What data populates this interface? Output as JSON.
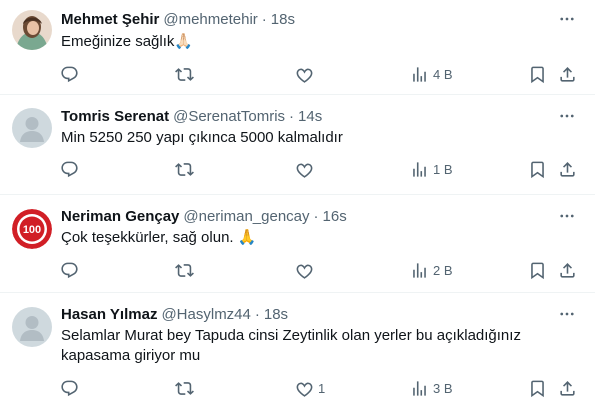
{
  "tweets": [
    {
      "name": "Mehmet Şehir",
      "handle": "@mehmetehir",
      "dot": "·",
      "time": "18s",
      "text": "Emeğinize sağlık",
      "emoji": "🙏🏻",
      "replies": "",
      "retweets": "",
      "likes": "",
      "views": "4 B"
    },
    {
      "name": "Tomris Serenat",
      "handle": "@SerenatTomris",
      "dot": "·",
      "time": "14s",
      "text": "Min 5250 250 yapı çıkınca 5000 kalmalıdır",
      "replies": "",
      "retweets": "",
      "likes": "",
      "views": "1 B"
    },
    {
      "name": "Neriman Gençay",
      "handle": "@neriman_gencay",
      "dot": "·",
      "time": "16s",
      "text": "Çok teşekkürler, sağ olun.",
      "emoji": "🙏",
      "avatar_text": "100",
      "replies": "",
      "retweets": "",
      "likes": "",
      "views": "2 B"
    },
    {
      "name": "Hasan Yılmaz",
      "handle": "@Hasylmz44",
      "dot": "·",
      "time": "18s",
      "text": "Selamlar Murat bey Tapuda cinsi Zeytinlik olan yerler bu açıkladığınız kapasama giriyor mu",
      "replies": "",
      "retweets": "",
      "likes": "1",
      "views": "3 B"
    }
  ],
  "icons": {
    "more": "more-horizontal-icon",
    "reply": "reply-icon",
    "retweet": "retweet-icon",
    "like": "heart-icon",
    "views": "views-chart-icon",
    "bookmark": "bookmark-icon",
    "share": "share-icon"
  },
  "colors": {
    "text_primary": "#0f1419",
    "text_secondary": "#536471",
    "divider": "#eff3f4",
    "default_avatar_bg": "#cfd9de",
    "neriman_avatar_red": "#d11f26"
  }
}
